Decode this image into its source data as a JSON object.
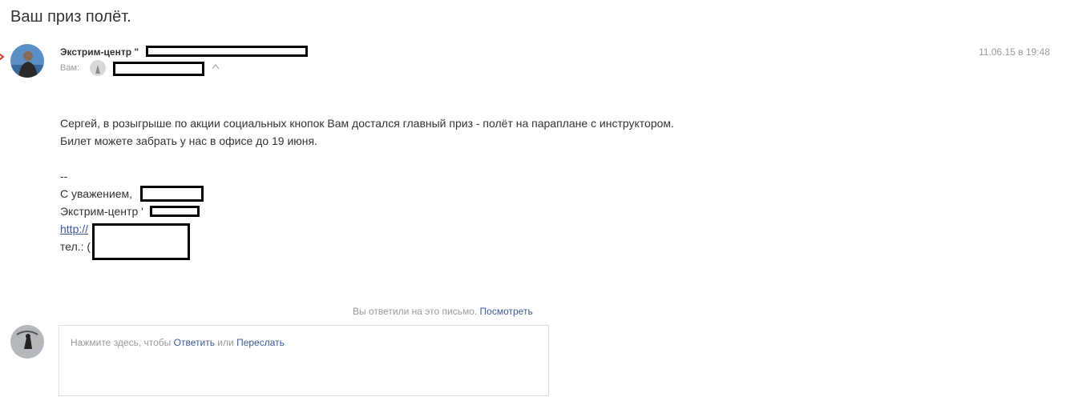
{
  "subject": "Ваш приз полёт.",
  "sender": {
    "name": "Экстрим-центр \"",
    "to_label": "Вам:",
    "date": "11.06.15 в 19:48"
  },
  "message": {
    "line1": "Сергей, в розыгрыше по акции социальных кнопок Вам достался главный приз - полёт на параплане с инструктором.",
    "line2": "Билет можете забрать у нас в офисе до 19 июня.",
    "separator": "--",
    "regards": "С уважением,",
    "company": "Экстрим-центр '",
    "link": "http://",
    "phone": "тел.: ("
  },
  "replied": {
    "text": "Вы ответили на это письмо.",
    "view_link": "Посмотреть"
  },
  "reply_box": {
    "prefix": "Нажмите здесь, чтобы",
    "reply_link": "Ответить",
    "or": "или",
    "forward_link": "Переслать"
  },
  "icons": {
    "flag": "flag-icon",
    "chevron": "chevron-up-icon"
  },
  "colors": {
    "link": "#3b5998",
    "muted": "#999999",
    "text": "#333333",
    "flag": "#d23b2b"
  }
}
